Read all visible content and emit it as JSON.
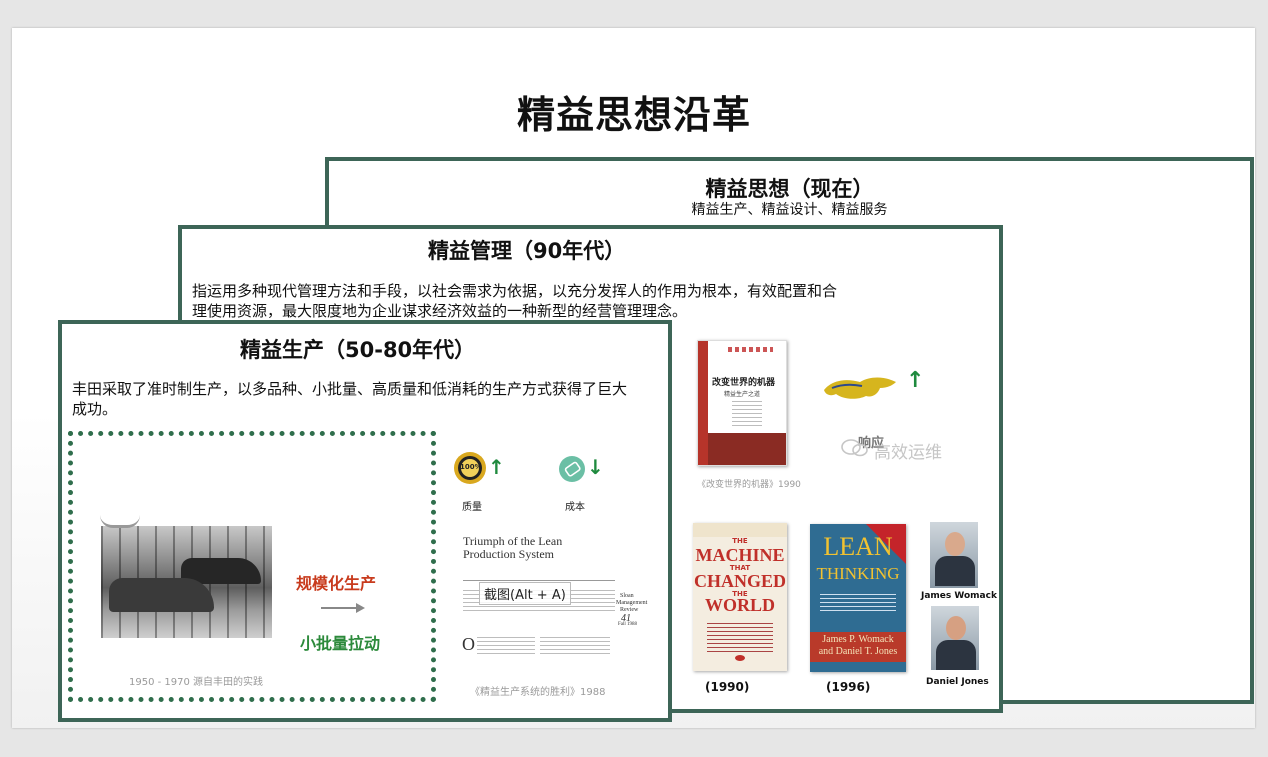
{
  "main_title": "精益思想沿革",
  "panel_now": {
    "title": "精益思想（现在）",
    "subtitle": "精益生产、精益设计、精益服务"
  },
  "panel_90s": {
    "title": "精益管理（90年代）",
    "description_line1": "指运用多种现代管理方法和手段，以社会需求为依据，以充分发挥人的作用为根本，有效配置和合",
    "description_line2": "理使用资源，最大限度地为企业谋求经济效益的一种新型的经营管理理念。",
    "book_1990_caption": "《改变世界的机器》1990",
    "book_cn_title": "改变世界的机器",
    "book_cn_subtitle": "精益生产之道",
    "response_label": "响应",
    "watermark": "高效运维",
    "machine_book_year": "(1990)",
    "lean_book_year": "(1996)",
    "person_1": "James Womack",
    "person_2": "Daniel Jones",
    "machine_cover": {
      "line1": "THE",
      "line2": "MACHINE",
      "line3": "THAT",
      "line4": "CHANGED",
      "line5": "THE",
      "line6": "WORLD"
    },
    "lean_cover": {
      "line1": "LEAN",
      "line2": "THINKING",
      "authors": "James P. Womack and Daniel T. Jones"
    }
  },
  "panel_50s": {
    "title": "精益生产（50-80年代）",
    "description_line1": "丰田采取了准时制生产，以多品种、小批量、高质量和低消耗的生产方式获得了巨大",
    "description_line2": "成功。",
    "left_caption": "1950 - 1970 源自丰田的实践",
    "from_label": "规模化生产",
    "to_label": "小批量拉动",
    "quality_label": "质量",
    "cost_label": "成本",
    "quality_badge": "100%",
    "article_title_line1": "Triumph of the Lean",
    "article_title_line2": "Production System",
    "article_issue_line1": "Sloan",
    "article_issue_line2": "Management",
    "article_issue_line3": "Review",
    "article_issue_number": "41",
    "article_issue_date": "Fall 1988",
    "screenshot_tip": "截图(Alt + A)",
    "right_caption": "《精益生产系统的胜利》1988"
  },
  "colors": {
    "panel_border": "#3d6557",
    "accent_red": "#c83b1d",
    "accent_green": "#2c8a3b",
    "dotted_border": "#2f6e4c"
  }
}
